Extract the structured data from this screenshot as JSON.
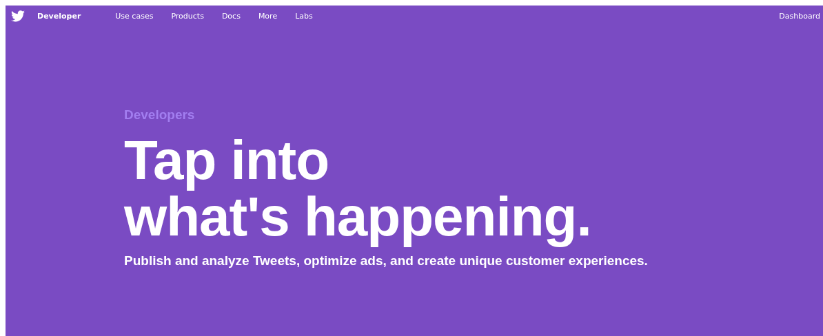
{
  "header": {
    "brand": "Developer",
    "nav": [
      {
        "label": "Use cases"
      },
      {
        "label": "Products"
      },
      {
        "label": "Docs"
      },
      {
        "label": "More"
      },
      {
        "label": "Labs"
      }
    ],
    "dashboard": "Dashboard"
  },
  "hero": {
    "eyebrow": "Developers",
    "headline": [
      "Tap into",
      "what's happening."
    ],
    "subtitle": "Publish and analyze Tweets, optimize ads, and create unique customer experiences."
  }
}
